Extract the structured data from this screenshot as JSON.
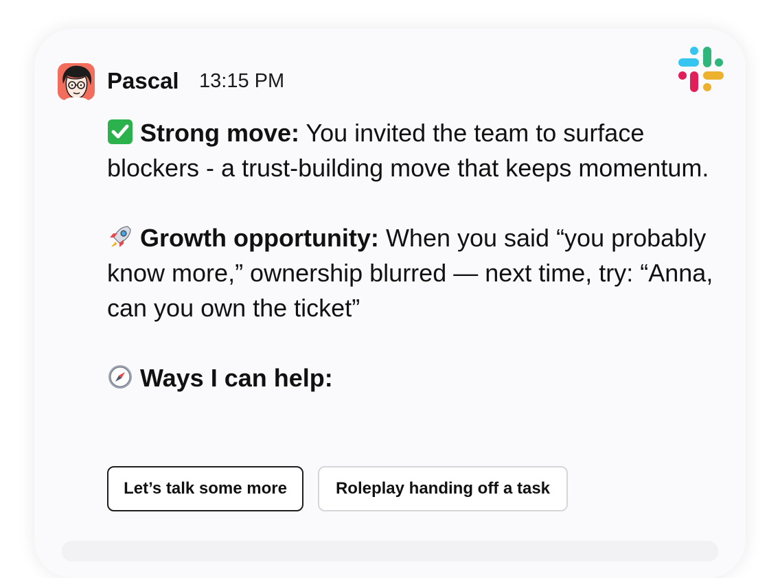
{
  "message": {
    "sender": "Pascal",
    "time": "13:15 PM",
    "avatar_icon": "pascal-avatar",
    "app_icon": "slack-logo-icon",
    "paragraphs": [
      {
        "emoji": "check-mark-icon",
        "heading": "Strong move:",
        "text": " You invited the team to surface blockers - a trust-building move that keeps momentum."
      },
      {
        "emoji": "rocket-icon",
        "heading": "Growth opportunity:",
        "text": " When you said “you probably know more,” ownership blurred — next time, try: “Anna, can you own the ticket”"
      },
      {
        "emoji": "compass-icon",
        "heading": "Ways I can help:",
        "text": ""
      }
    ],
    "actions": [
      {
        "label": "Let’s talk some more",
        "style": "primary"
      },
      {
        "label": "Roleplay handing off a task",
        "style": "secondary"
      }
    ]
  },
  "colors": {
    "card_bg": "#fafafc",
    "text": "#111111",
    "avatar_bg": "#f26d5b",
    "check_green": "#2bb24c",
    "slack_blue": "#36c5f0",
    "slack_green": "#2eb67d",
    "slack_red": "#e01e5a",
    "slack_yellow": "#ecb22e"
  }
}
